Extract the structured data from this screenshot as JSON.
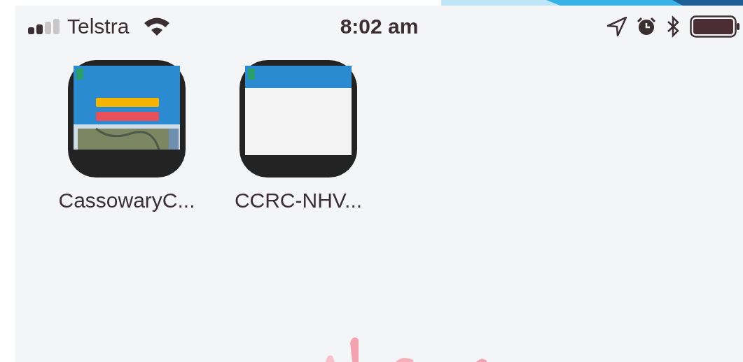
{
  "status_bar": {
    "carrier": "Telstra",
    "time": "8:02 am"
  },
  "apps": [
    {
      "label": "CassowaryC...",
      "kind": "map_page"
    },
    {
      "label": "CCRC-NHV...",
      "kind": "blank_page"
    }
  ]
}
